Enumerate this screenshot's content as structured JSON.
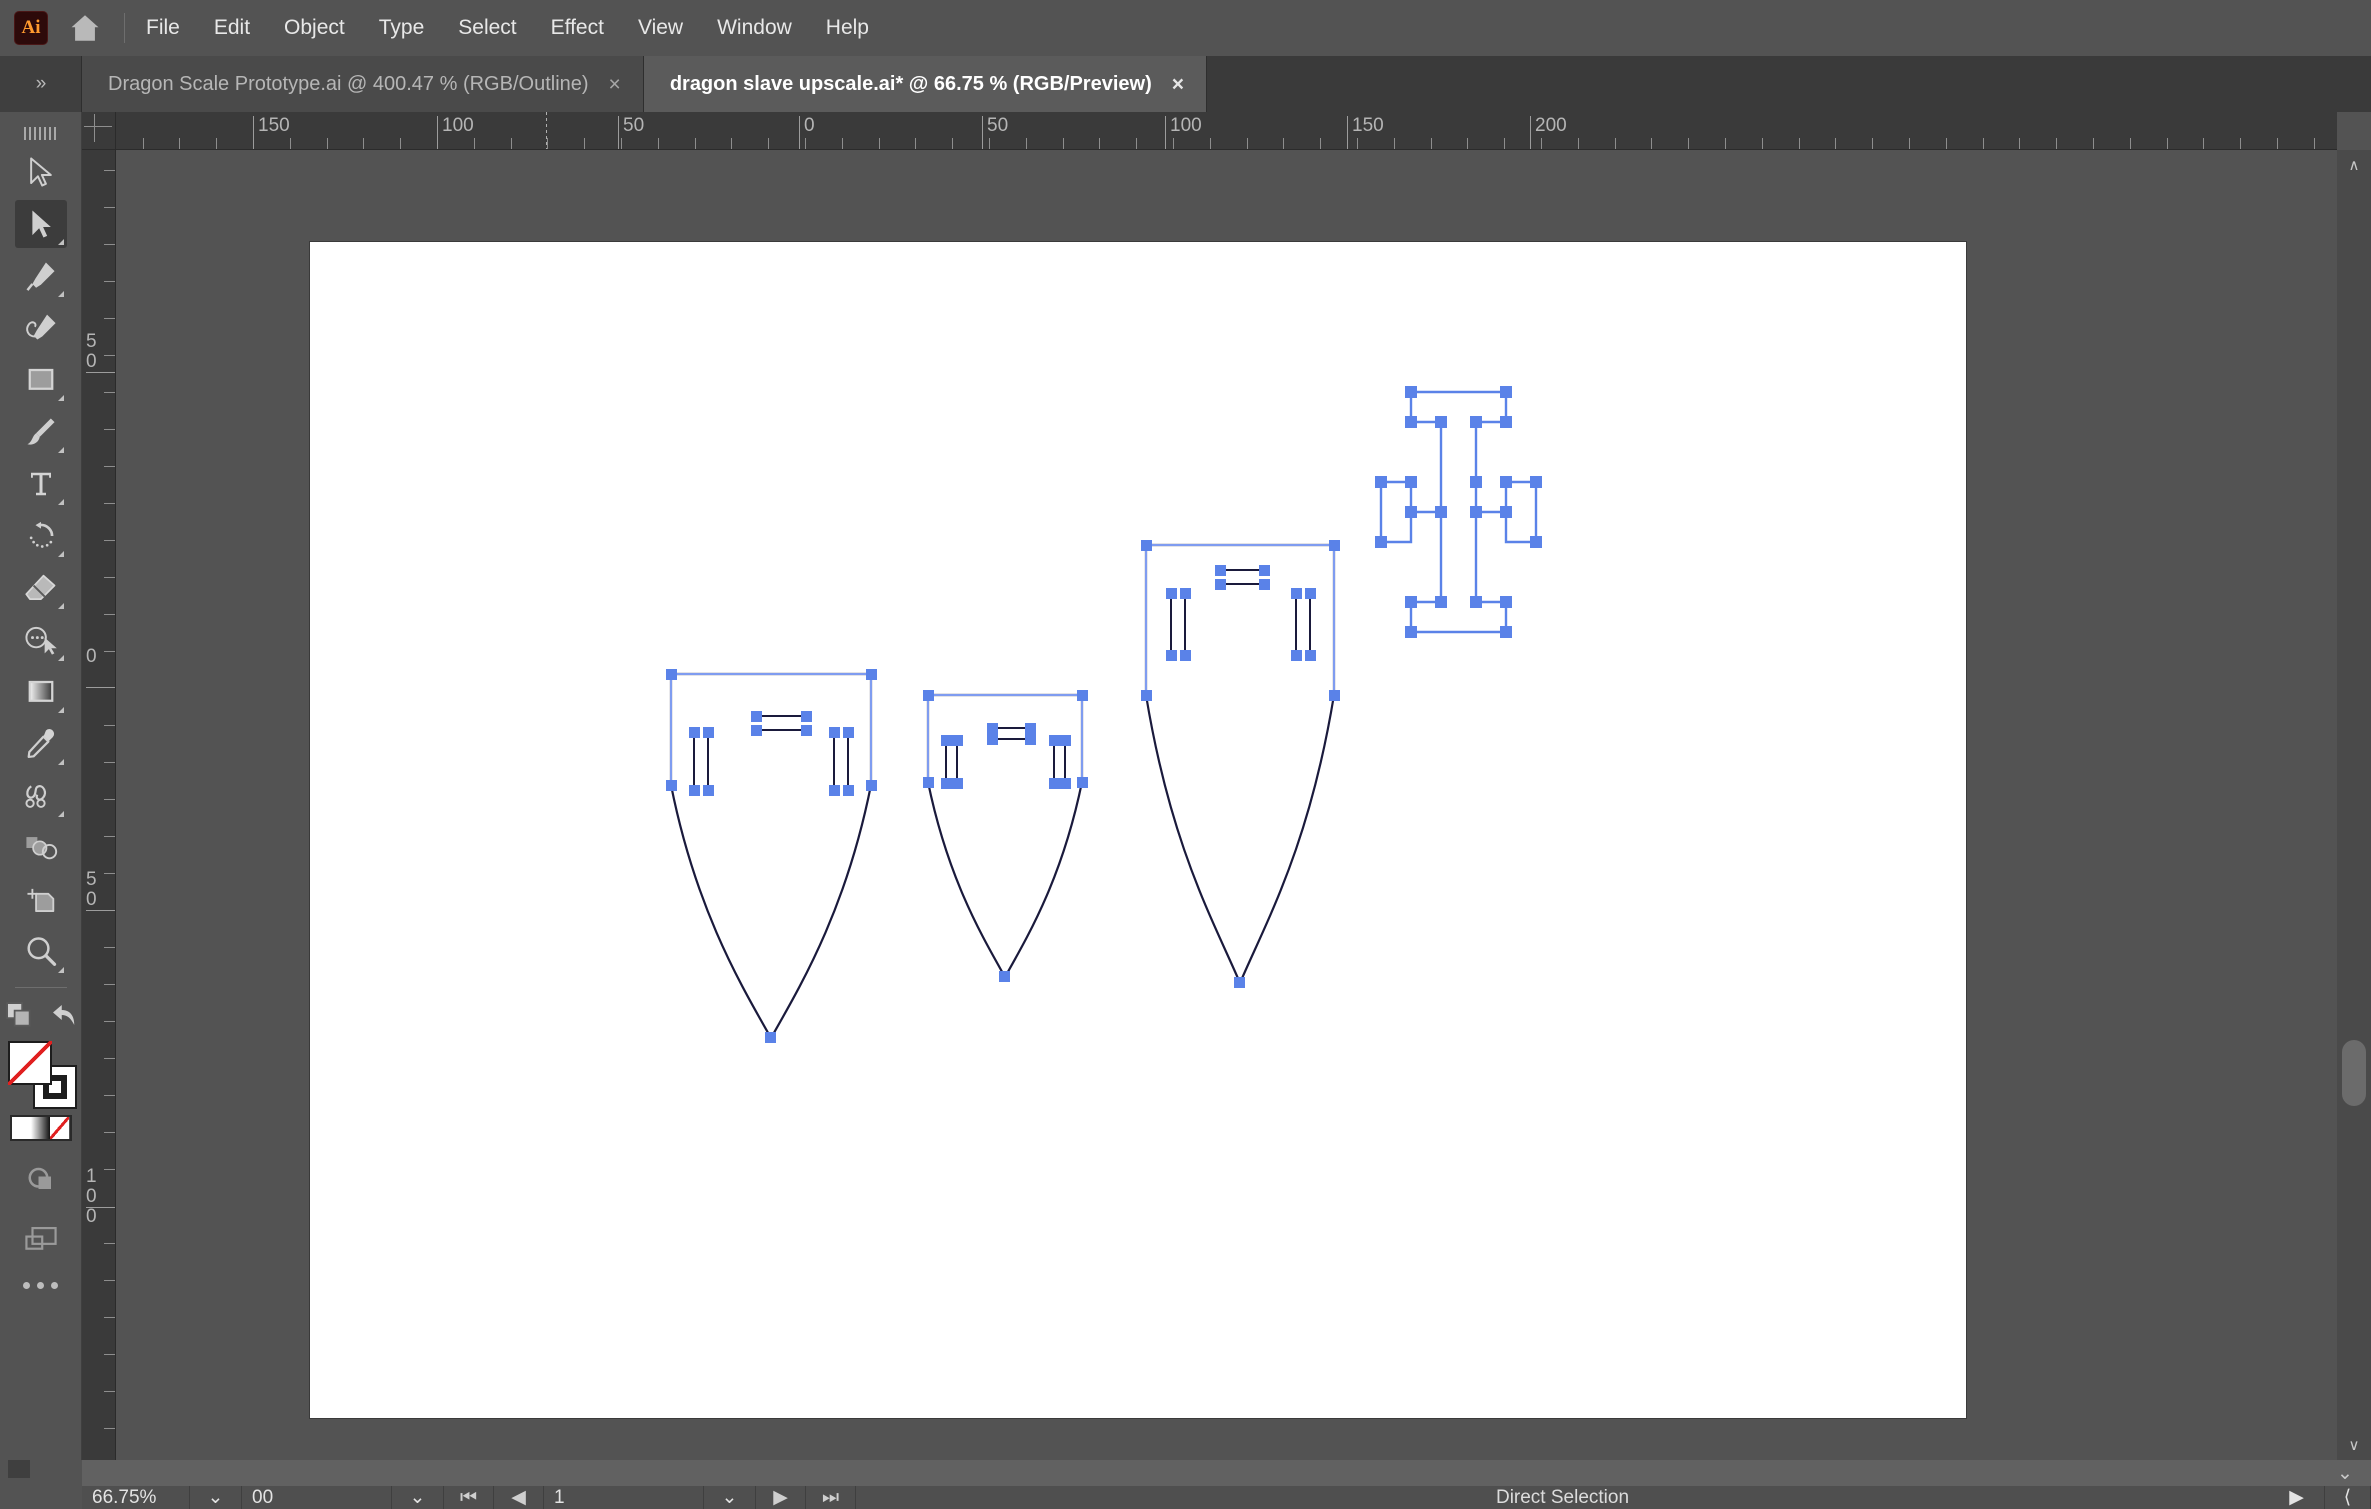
{
  "app": {
    "name": "Adobe Illustrator",
    "logo_text": "Ai",
    "home_icon": "home-icon"
  },
  "menubar": {
    "items": [
      {
        "label": "File"
      },
      {
        "label": "Edit"
      },
      {
        "label": "Object"
      },
      {
        "label": "Type"
      },
      {
        "label": "Select"
      },
      {
        "label": "Effect"
      },
      {
        "label": "View"
      },
      {
        "label": "Window"
      },
      {
        "label": "Help"
      }
    ]
  },
  "tabbar": {
    "expand_label": "»",
    "tabs": [
      {
        "title": "Dragon Scale Prototype.ai @ 400.47 % (RGB/Outline)",
        "close": "×",
        "active": false
      },
      {
        "title": "dragon slave upscale.ai* @ 66.75 % (RGB/Preview)",
        "close": "×",
        "active": true
      }
    ]
  },
  "toolbar": {
    "grip": "toolbar-grip",
    "tools": [
      {
        "name": "selection-tool",
        "selected": false,
        "flyout": false
      },
      {
        "name": "direct-selection-tool",
        "selected": true,
        "flyout": true
      },
      {
        "name": "pen-tool",
        "selected": false,
        "flyout": true
      },
      {
        "name": "curvature-tool",
        "selected": false,
        "flyout": false
      },
      {
        "name": "rectangle-tool",
        "selected": false,
        "flyout": true
      },
      {
        "name": "paintbrush-tool",
        "selected": false,
        "flyout": true
      },
      {
        "name": "type-tool",
        "selected": false,
        "flyout": true
      },
      {
        "name": "rotate-tool",
        "selected": false,
        "flyout": true
      },
      {
        "name": "eraser-tool",
        "selected": false,
        "flyout": true
      },
      {
        "name": "shape-builder-tool",
        "selected": false,
        "flyout": true
      },
      {
        "name": "gradient-tool",
        "selected": false,
        "flyout": true
      },
      {
        "name": "eyedropper-tool",
        "selected": false,
        "flyout": true
      },
      {
        "name": "blend-tool",
        "selected": false,
        "flyout": false
      },
      {
        "name": "free-transform-tool",
        "selected": false,
        "flyout": false
      },
      {
        "name": "artboard-tool",
        "selected": false,
        "flyout": false
      },
      {
        "name": "zoom-tool",
        "selected": false,
        "flyout": true
      }
    ],
    "arrange_icon": "arrange-documents-icon",
    "undo_icon": "undo-arrow-icon",
    "fill_label": "fill-swatch-none",
    "stroke_label": "stroke-swatch-black",
    "color_modes": [
      {
        "name": "color-swatch-white"
      },
      {
        "name": "gradient-swatch"
      },
      {
        "name": "none-swatch"
      }
    ],
    "drawing_mode_icon": "drawing-modes-icon",
    "screen_mode_icon": "screen-mode-icon",
    "more_tools": "•••"
  },
  "rulers": {
    "unit": "mm",
    "horizontal_labels": [
      "150",
      "100",
      "50",
      "0",
      "50",
      "100",
      "150",
      "200"
    ],
    "vertical_labels": [
      "50",
      "0",
      "50",
      "100"
    ]
  },
  "canvas": {
    "artboard_background": "#ffffff",
    "canvas_background": "#535353",
    "anchor_color": "#5a82e8",
    "path_color": "#1a1a3c",
    "shapes": [
      {
        "name": "shield-1",
        "type": "shield-outline"
      },
      {
        "name": "shield-2",
        "type": "shield-outline"
      },
      {
        "name": "shield-3",
        "type": "shield-outline"
      },
      {
        "name": "cross-outline",
        "type": "cross-outline"
      }
    ]
  },
  "scrollbars": {
    "vertical_up": "∧",
    "vertical_down": "∨",
    "horizontal_right": "〉"
  },
  "statusbar": {
    "zoom_level": "66.75%",
    "zoom_caret": "⌄",
    "artboard_number": "00",
    "artboard_caret": "⌄",
    "nav_first": "⏮",
    "nav_prev": "◀",
    "page_value": "1",
    "page_caret": "⌄",
    "nav_next": "▶",
    "nav_last": "⏭",
    "active_tool": "Direct Selection",
    "play_icon": "▶",
    "grip_icon": "⟨",
    "right_collapse": "⌄"
  }
}
